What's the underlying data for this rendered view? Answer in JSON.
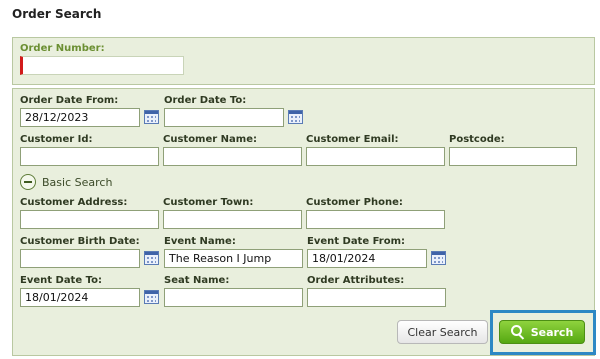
{
  "page": {
    "title": "Order Search"
  },
  "order_number": {
    "label": "Order Number:",
    "value": ""
  },
  "order_date_from": {
    "label": "Order Date From:",
    "value": "28/12/2023"
  },
  "order_date_to": {
    "label": "Order Date To:",
    "value": ""
  },
  "customer_id": {
    "label": "Customer Id:",
    "value": ""
  },
  "customer_name": {
    "label": "Customer Name:",
    "value": ""
  },
  "customer_email": {
    "label": "Customer Email:",
    "value": ""
  },
  "postcode": {
    "label": "Postcode:",
    "value": ""
  },
  "basic_search_toggle": {
    "label": "Basic Search",
    "icon": "collapse-minus-icon"
  },
  "customer_address": {
    "label": "Customer Address:",
    "value": ""
  },
  "customer_town": {
    "label": "Customer Town:",
    "value": ""
  },
  "customer_phone": {
    "label": "Customer Phone:",
    "value": ""
  },
  "customer_birth_date": {
    "label": "Customer Birth Date:",
    "value": ""
  },
  "event_name": {
    "label": "Event Name:",
    "value": "The Reason I Jump"
  },
  "event_date_from": {
    "label": "Event Date From:",
    "value": "18/01/2024"
  },
  "event_date_to": {
    "label": "Event Date To:",
    "value": "18/01/2024"
  },
  "seat_name": {
    "label": "Seat Name:",
    "value": ""
  },
  "order_attributes": {
    "label": "Order Attributes:",
    "value": ""
  },
  "buttons": {
    "clear": "Clear Search",
    "search": "Search"
  },
  "colors": {
    "panel_bg": "#e9efdd",
    "panel_border": "#b9c8a1",
    "search_green": "#55a812",
    "highlight_blue": "#2d88c4",
    "required_red": "#d21b1b"
  }
}
